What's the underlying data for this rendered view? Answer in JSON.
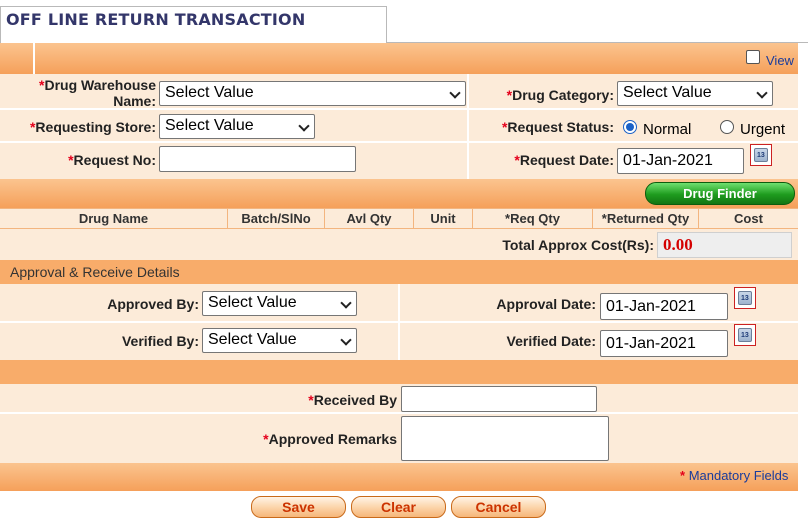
{
  "header": {
    "title": "OFF LINE RETURN TRANSACTION",
    "view_label": "View"
  },
  "request": {
    "drug_warehouse": {
      "label_line1": "Drug Warehouse",
      "label_line2": "Name:",
      "value": "Select Value"
    },
    "drug_category": {
      "label": "Drug Category:",
      "value": "Select Value"
    },
    "requesting_store": {
      "label": "Requesting Store:",
      "value": "Select Value"
    },
    "request_status": {
      "label": "Request Status:",
      "options": [
        "Normal",
        "Urgent"
      ],
      "selected": "Normal"
    },
    "request_no": {
      "label": "Request No:",
      "value": ""
    },
    "request_date": {
      "label": "Request Date:",
      "value": "01-Jan-2021"
    }
  },
  "drug_finder": {
    "label": "Drug Finder"
  },
  "table": {
    "columns": [
      "Drug Name",
      "Batch/SlNo",
      "Avl Qty",
      "Unit",
      "*Req Qty",
      "*Returned Qty",
      "Cost"
    ]
  },
  "total": {
    "label": "Total Approx Cost(Rs):",
    "value": "0.00"
  },
  "approval": {
    "section_title": "Approval & Receive Details",
    "approved_by": {
      "label": "Approved By:",
      "value": "Select Value"
    },
    "approval_date": {
      "label": "Approval Date:",
      "value": "01-Jan-2021"
    },
    "verified_by": {
      "label": "Verified By:",
      "value": "Select Value"
    },
    "verified_date": {
      "label": "Verified Date:",
      "value": "01-Jan-2021"
    }
  },
  "receive": {
    "received_by": {
      "label": "Received By",
      "value": ""
    },
    "approved_remarks": {
      "label": "Approved Remarks",
      "value": ""
    }
  },
  "footer": {
    "mandatory_star": "*",
    "mandatory_label": "Mandatory Fields"
  },
  "buttons": {
    "save": "Save",
    "clear": "Clear",
    "cancel": "Cancel"
  },
  "colors": {
    "accent_orange": "#f8ac6a",
    "cream": "#fcebd9",
    "mandatory_red": "#e4001b",
    "total_red": "#d40000",
    "drug_finder_green": "#1e9c1e"
  }
}
